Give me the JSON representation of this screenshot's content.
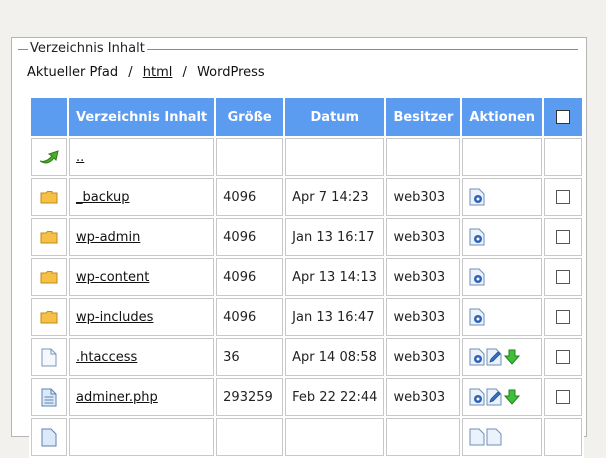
{
  "panel": {
    "legend": "Verzeichnis Inhalt",
    "path_label": "Aktueller Pfad",
    "path_sep1": "/",
    "path_link": "html",
    "path_sep2": "/",
    "path_current": "WordPress"
  },
  "table": {
    "headers": {
      "name": "Verzeichnis Inhalt",
      "size": "Größe",
      "date": "Datum",
      "owner": "Besitzer",
      "actions": "Aktionen"
    },
    "parent": {
      "name": "..",
      "icon": "up-arrow-icon"
    },
    "rows": [
      {
        "name": "_backup",
        "size": "4096",
        "date": "Apr 7 14:23",
        "owner": "web303",
        "icon": "folder-icon"
      },
      {
        "name": "wp-admin",
        "size": "4096",
        "date": "Jan 13 16:17",
        "owner": "web303",
        "icon": "folder-icon"
      },
      {
        "name": "wp-content",
        "size": "4096",
        "date": "Apr 13 14:13",
        "owner": "web303",
        "icon": "folder-icon"
      },
      {
        "name": "wp-includes",
        "size": "4096",
        "date": "Jan 13 16:47",
        "owner": "web303",
        "icon": "folder-icon"
      },
      {
        "name": ".htaccess",
        "size": "36",
        "date": "Apr 14 08:58",
        "owner": "web303",
        "icon": "file-icon"
      },
      {
        "name": "adminer.php",
        "size": "293259",
        "date": "Feb 22 22:44",
        "owner": "web303",
        "icon": "php-file-icon"
      }
    ]
  },
  "colors": {
    "header_bg": "#5b9bf0",
    "folder": "#f5c046",
    "page_bg": "#f3f1ee"
  }
}
